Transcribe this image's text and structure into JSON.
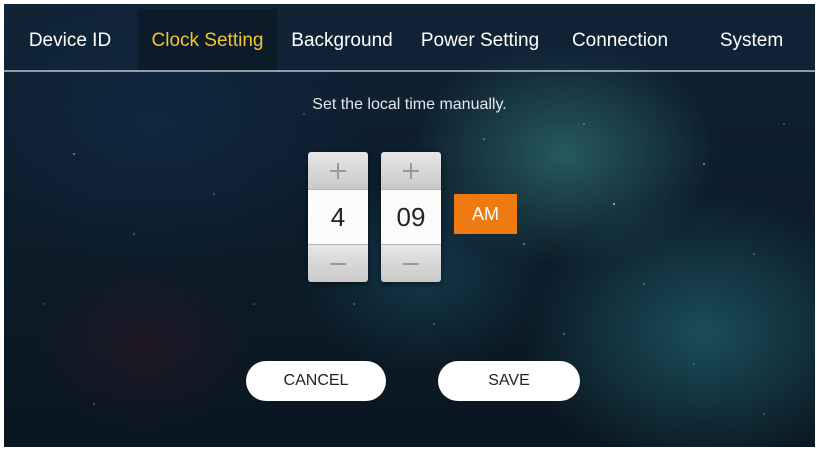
{
  "tabs": [
    {
      "label": "Device ID",
      "active": false
    },
    {
      "label": "Clock Setting",
      "active": true
    },
    {
      "label": "Background",
      "active": false
    },
    {
      "label": "Power Setting",
      "active": false
    },
    {
      "label": "Connection",
      "active": false
    },
    {
      "label": "System",
      "active": false
    }
  ],
  "clock": {
    "instruction": "Set the local time manually.",
    "hour": "4",
    "minute": "09",
    "period": "AM",
    "increment_icon": "plus-icon",
    "decrement_icon": "minus-icon"
  },
  "actions": {
    "cancel_label": "CANCEL",
    "save_label": "SAVE"
  },
  "colors": {
    "active_tab_text": "#f2c431",
    "period_button": "#f07a12"
  }
}
